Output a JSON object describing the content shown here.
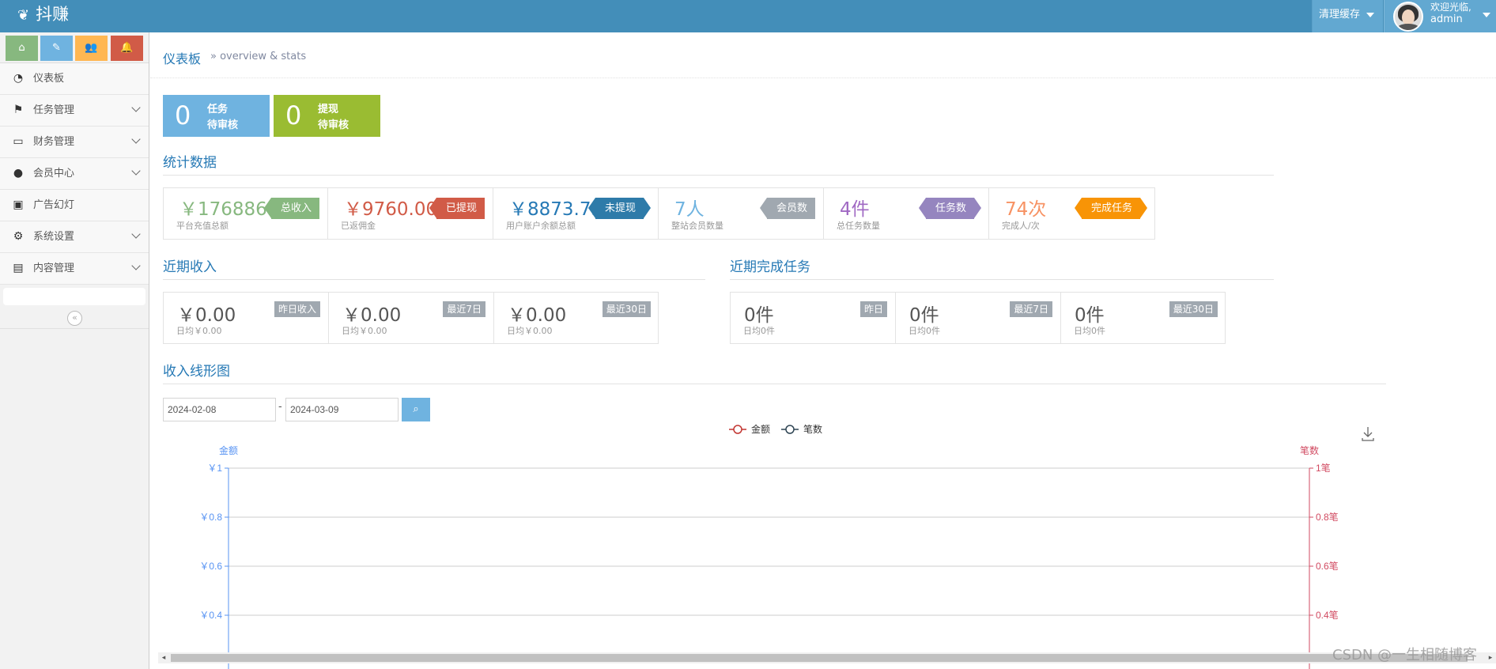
{
  "header": {
    "brand": "抖赚",
    "cache_button": "清理缓存",
    "welcome": "欢迎光临,",
    "username": "admin"
  },
  "sidebar": {
    "shortcuts": [
      "home-icon",
      "pencil-icon",
      "users-icon",
      "bell-icon"
    ],
    "items": [
      {
        "label": "仪表板",
        "icon": "dashboard-icon",
        "has_children": false
      },
      {
        "label": "任务管理",
        "icon": "flag-icon",
        "has_children": true
      },
      {
        "label": "财务管理",
        "icon": "inbox-icon",
        "has_children": true
      },
      {
        "label": "会员中心",
        "icon": "user-icon",
        "has_children": true
      },
      {
        "label": "广告幻灯",
        "icon": "picture-icon",
        "has_children": false
      },
      {
        "label": "系统设置",
        "icon": "gear-icon",
        "has_children": true
      },
      {
        "label": "内容管理",
        "icon": "book-icon",
        "has_children": true
      }
    ]
  },
  "page": {
    "title": "仪表板",
    "subtitle": "» overview & stats"
  },
  "pending": [
    {
      "value": "0",
      "line1": "任务",
      "line2": "待审核",
      "color": "#6fb3e0"
    },
    {
      "value": "0",
      "line1": "提现",
      "line2": "待审核",
      "color": "#9abc32"
    }
  ],
  "stats": {
    "title": "统计数据",
    "items": [
      {
        "value": "￥176886.00",
        "desc": "平台充值总额",
        "badge": "总收入",
        "value_color": "#87b87f",
        "badge_color": "#87b87f"
      },
      {
        "value": "￥9760.00",
        "desc": "已返佣金",
        "badge": "已提现",
        "value_color": "#d15b47",
        "badge_color": "#d15b47"
      },
      {
        "value": "￥8873.73",
        "desc": "用户账户余额总额",
        "badge": "未提现",
        "value_color": "#2679b5",
        "badge_color": "#2e7ba9"
      },
      {
        "value": "7人",
        "desc": "整站会员数量",
        "badge": "会员数",
        "value_color": "#6fb3e0",
        "badge_color": "#a0a8b0"
      },
      {
        "value": "4件",
        "desc": "总任务数量",
        "badge": "任务数",
        "value_color": "#a069c3",
        "badge_color": "#9585bf"
      },
      {
        "value": "74次",
        "desc": "完成人/次",
        "badge": "完成任务",
        "value_color": "#f79263",
        "badge_color": "#f89406"
      }
    ]
  },
  "income": {
    "title": "近期收入",
    "items": [
      {
        "value": "￥0.00",
        "desc": "日均￥0.00",
        "badge": "昨日收入"
      },
      {
        "value": "￥0.00",
        "desc": "日均￥0.00",
        "badge": "最近7日"
      },
      {
        "value": "￥0.00",
        "desc": "日均￥0.00",
        "badge": "最近30日"
      }
    ]
  },
  "tasks": {
    "title": "近期完成任务",
    "items": [
      {
        "value": "0件",
        "desc": "日均0件",
        "badge": "昨日"
      },
      {
        "value": "0件",
        "desc": "日均0件",
        "badge": "最近7日"
      },
      {
        "value": "0件",
        "desc": "日均0件",
        "badge": "最近30日"
      }
    ]
  },
  "line_chart_section": {
    "title": "收入线形图",
    "start_date": "2024-02-08",
    "separator": "-",
    "end_date": "2024-03-09"
  },
  "chart_data": {
    "type": "line",
    "legend_placement": "top-center",
    "series": [
      {
        "name": "金额",
        "color": "#c23531",
        "values": []
      },
      {
        "name": "笔数",
        "color": "#2f4554",
        "values": []
      }
    ],
    "y_left": {
      "label": "金额",
      "ticks": [
        "￥1",
        "￥0.8",
        "￥0.6",
        "￥0.4"
      ],
      "ylim": [
        0,
        1
      ],
      "color": "#5793f3"
    },
    "y_right": {
      "label": "笔数",
      "ticks": [
        "1笔",
        "0.8笔",
        "0.6笔",
        "0.4笔"
      ],
      "ylim": [
        0,
        1
      ],
      "color": "#d14a61"
    },
    "grid": true
  },
  "watermark": "CSDN @一生相随博客"
}
